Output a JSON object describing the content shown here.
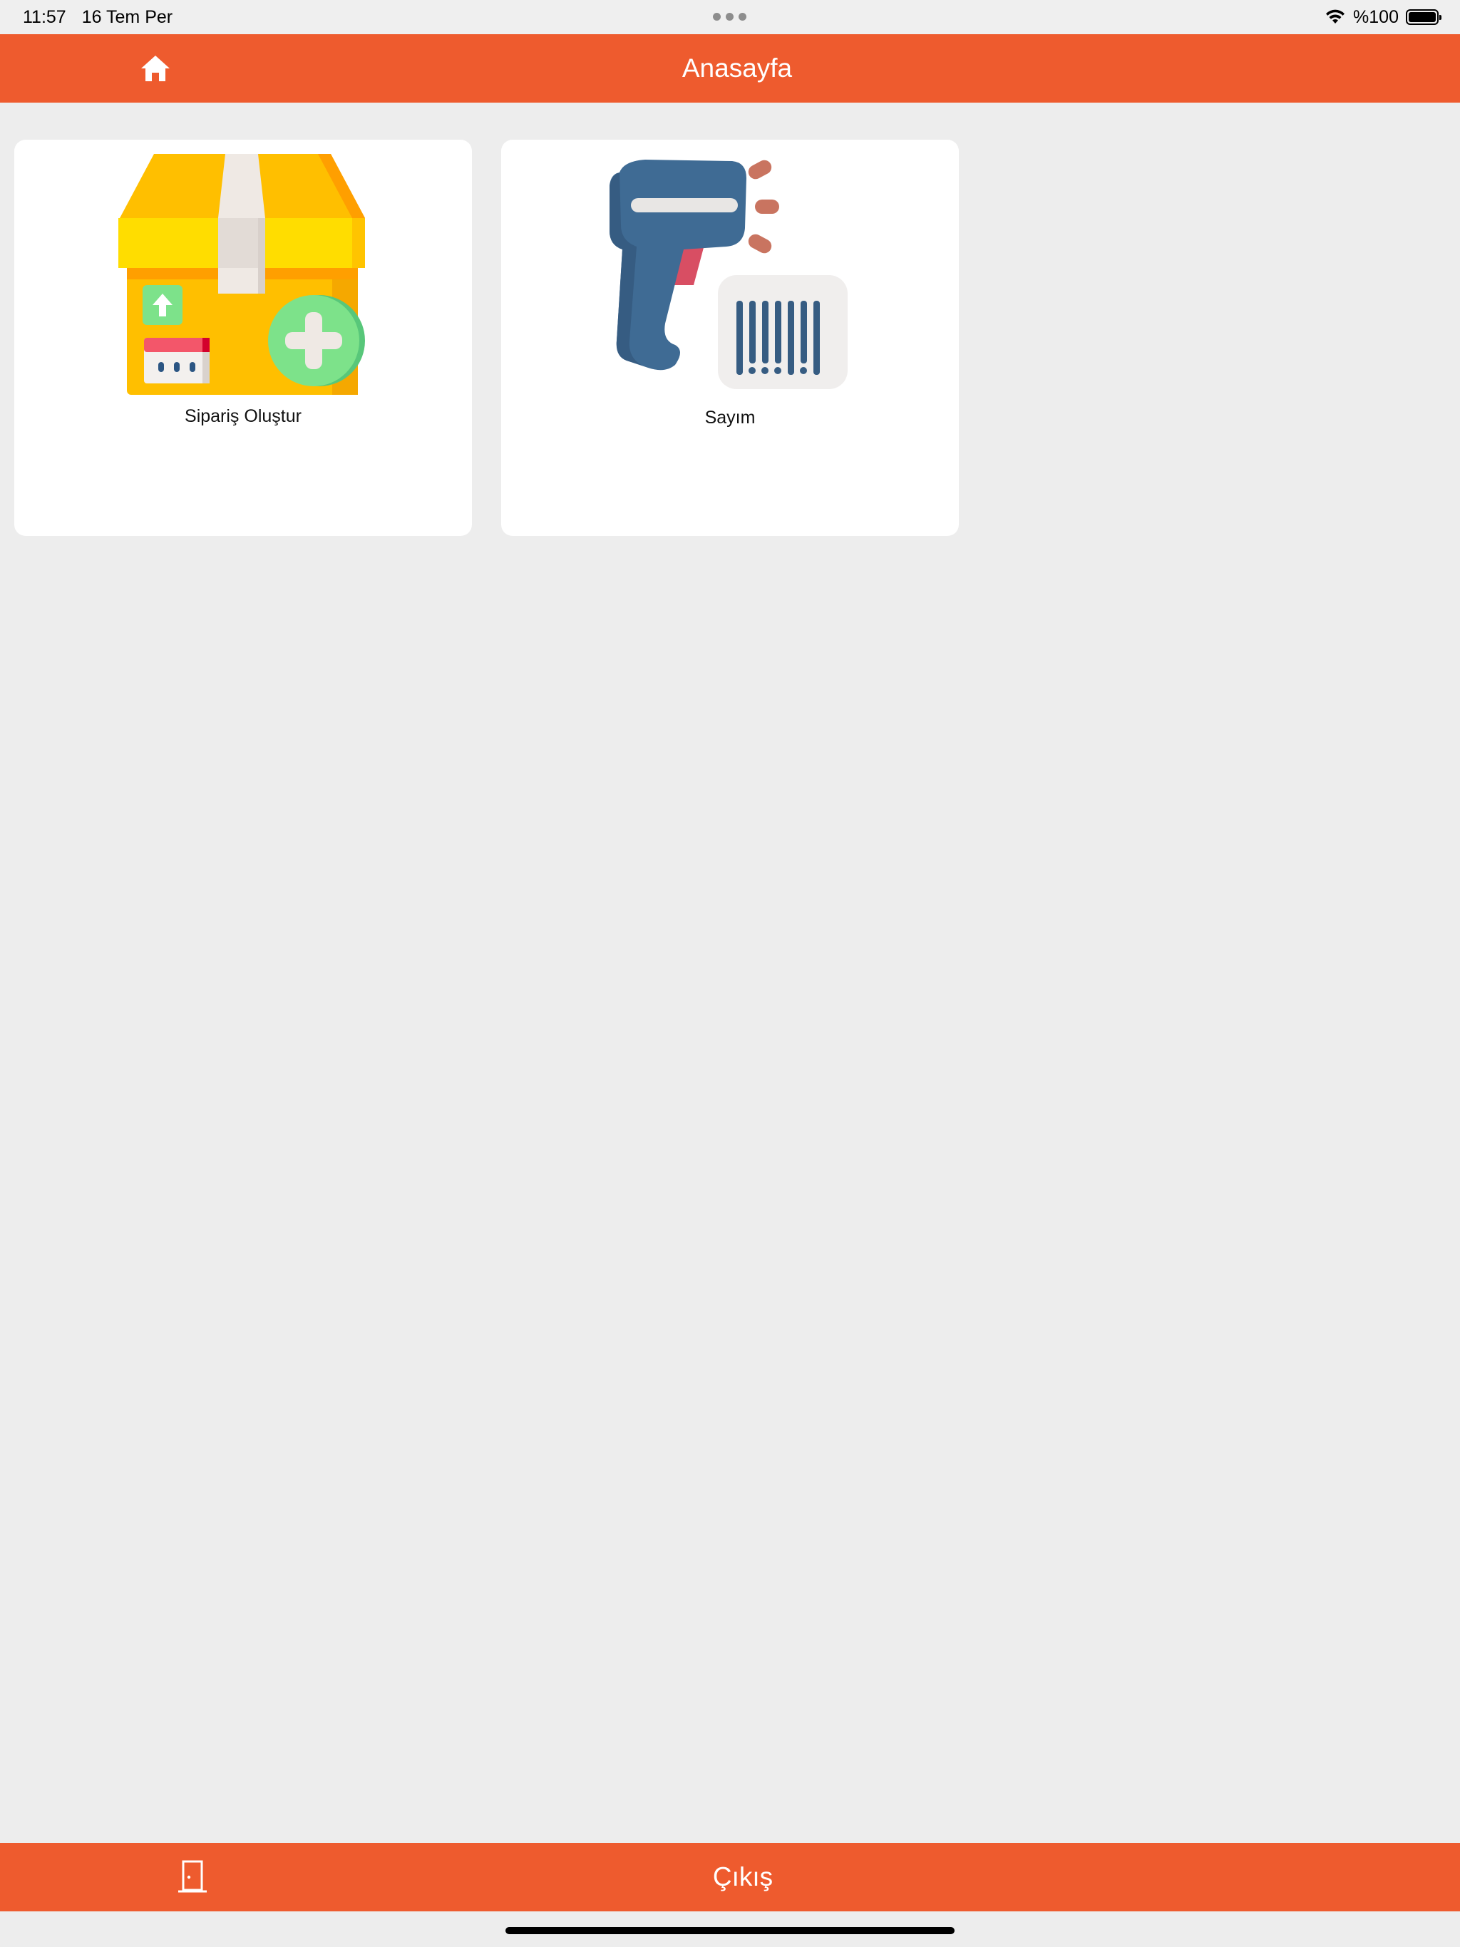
{
  "status_bar": {
    "time": "11:57",
    "date": "16 Tem Per",
    "battery": "%100",
    "icons": [
      "wifi-icon",
      "battery-icon"
    ]
  },
  "header": {
    "title": "Anasayfa",
    "home_icon": "home-icon"
  },
  "cards": [
    {
      "label": "Sipariş Oluştur",
      "icon": "create-order-box-icon"
    },
    {
      "label": "Sayım",
      "icon": "barcode-scanner-icon"
    }
  ],
  "footer": {
    "label": "Çıkış",
    "icon": "logout-door-icon"
  },
  "colors": {
    "accent": "#ee5b2e",
    "background": "#ededed",
    "card": "#ffffff"
  }
}
